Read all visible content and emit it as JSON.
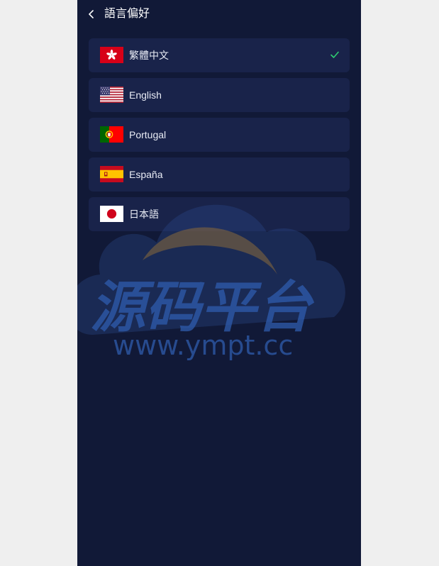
{
  "header": {
    "title": "語言偏好",
    "back_icon": "chevron-left-icon"
  },
  "languages": [
    {
      "label": "繁體中文",
      "flag": "hong-kong-flag-icon",
      "selected": true
    },
    {
      "label": "English",
      "flag": "us-flag-icon",
      "selected": false
    },
    {
      "label": "Portugal",
      "flag": "portugal-flag-icon",
      "selected": false
    },
    {
      "label": "España",
      "flag": "spain-flag-icon",
      "selected": false
    },
    {
      "label": "日本語",
      "flag": "japan-flag-icon",
      "selected": false
    }
  ],
  "selected_check_icon": "checkmark-icon",
  "watermark": {
    "chinese_text": "源码平台",
    "url_text": "www.ympt.cc"
  },
  "colors": {
    "background": "#111937",
    "item_background": "#19234a",
    "check": "#2ecc71",
    "outside": "#efefef"
  }
}
